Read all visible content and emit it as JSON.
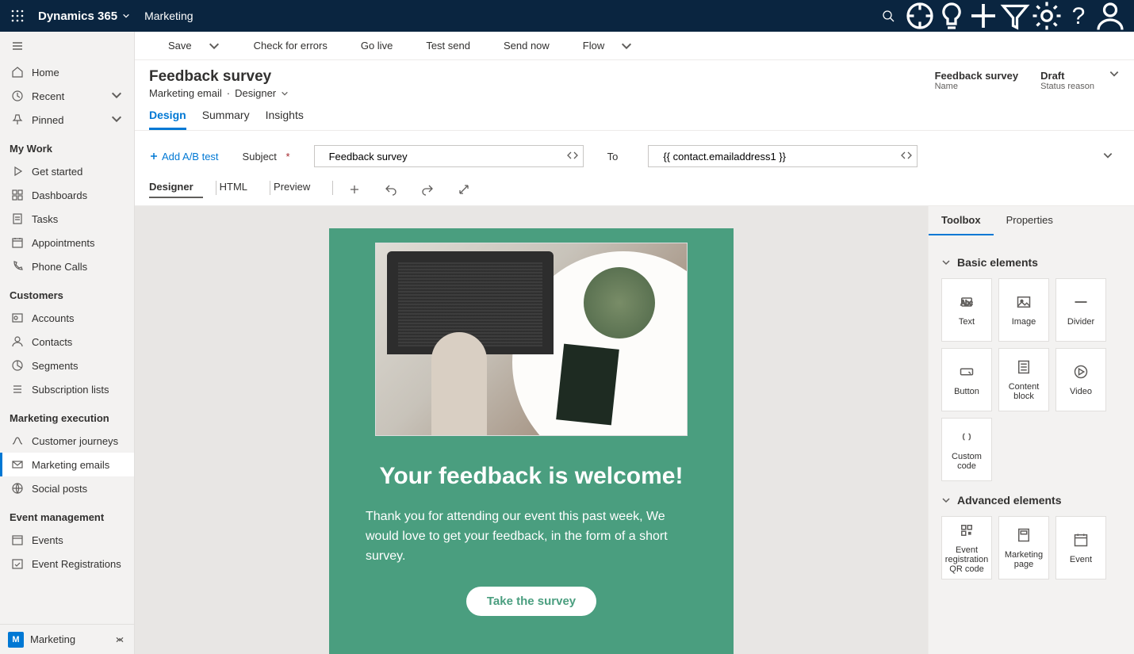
{
  "topbar": {
    "brand": "Dynamics 365",
    "module": "Marketing"
  },
  "sidebar": {
    "top": [
      {
        "label": "Home",
        "icon": "home"
      },
      {
        "label": "Recent",
        "icon": "clock",
        "chev": true
      },
      {
        "label": "Pinned",
        "icon": "pin",
        "chev": true
      }
    ],
    "groups": [
      {
        "label": "My Work",
        "items": [
          {
            "label": "Get started",
            "icon": "play"
          },
          {
            "label": "Dashboards",
            "icon": "dash"
          },
          {
            "label": "Tasks",
            "icon": "task"
          },
          {
            "label": "Appointments",
            "icon": "appt"
          },
          {
            "label": "Phone Calls",
            "icon": "phone"
          }
        ]
      },
      {
        "label": "Customers",
        "items": [
          {
            "label": "Accounts",
            "icon": "account"
          },
          {
            "label": "Contacts",
            "icon": "contact"
          },
          {
            "label": "Segments",
            "icon": "segment"
          },
          {
            "label": "Subscription lists",
            "icon": "sublist"
          }
        ]
      },
      {
        "label": "Marketing execution",
        "items": [
          {
            "label": "Customer journeys",
            "icon": "journey"
          },
          {
            "label": "Marketing emails",
            "icon": "email",
            "active": true
          },
          {
            "label": "Social posts",
            "icon": "social"
          }
        ]
      },
      {
        "label": "Event management",
        "items": [
          {
            "label": "Events",
            "icon": "event"
          },
          {
            "label": "Event Registrations",
            "icon": "eventreg"
          }
        ]
      }
    ],
    "footer": {
      "badge": "M",
      "label": "Marketing"
    }
  },
  "cmdbar": [
    {
      "name": "save",
      "label": "Save",
      "icon": "save",
      "split": true
    },
    {
      "name": "check",
      "label": "Check for errors",
      "icon": "info"
    },
    {
      "name": "golive",
      "label": "Go live",
      "icon": "check"
    },
    {
      "name": "testsend",
      "label": "Test send",
      "icon": "mail"
    },
    {
      "name": "sendnow",
      "label": "Send now",
      "icon": "send"
    },
    {
      "name": "flow",
      "label": "Flow",
      "icon": "flow",
      "split": true
    }
  ],
  "record": {
    "title": "Feedback survey",
    "entity": "Marketing email",
    "view": "Designer",
    "meta": [
      {
        "value": "Feedback survey",
        "label": "Name"
      },
      {
        "value": "Draft",
        "label": "Status reason"
      }
    ]
  },
  "tabs": [
    {
      "label": "Design",
      "active": true
    },
    {
      "label": "Summary"
    },
    {
      "label": "Insights"
    }
  ],
  "fields": {
    "ab": "Add A/B test",
    "subject_label": "Subject",
    "subject_value": "Feedback survey",
    "to_label": "To",
    "to_value": "{{ contact.emailaddress1 }}"
  },
  "subtabs": [
    {
      "label": "Designer",
      "active": true
    },
    {
      "label": "HTML"
    },
    {
      "label": "Preview"
    }
  ],
  "email": {
    "headline": "Your feedback is welcome!",
    "body": "Thank you for attending our event this past week, We would love to get your feedback, in the form of a short survey.",
    "cta": "Take the survey",
    "accent": "#4a9e7f"
  },
  "toolbox": {
    "tabs": [
      {
        "label": "Toolbox",
        "active": true
      },
      {
        "label": "Properties"
      }
    ],
    "basic_label": "Basic elements",
    "basic": [
      {
        "label": "Text",
        "icon": "text"
      },
      {
        "label": "Image",
        "icon": "image"
      },
      {
        "label": "Divider",
        "icon": "divider"
      },
      {
        "label": "Button",
        "icon": "button"
      },
      {
        "label": "Content block",
        "icon": "block"
      },
      {
        "label": "Video",
        "icon": "video"
      },
      {
        "label": "Custom code",
        "icon": "code"
      }
    ],
    "advanced_label": "Advanced elements",
    "advanced": [
      {
        "label": "Event registration QR code",
        "icon": "qr"
      },
      {
        "label": "Marketing page",
        "icon": "mpage"
      },
      {
        "label": "Event",
        "icon": "mevent"
      }
    ]
  }
}
